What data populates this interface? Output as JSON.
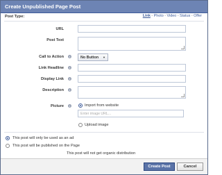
{
  "dialog": {
    "title": "Create Unpublished Page Post"
  },
  "post_type": {
    "label": "Post Type:",
    "options": [
      "Link",
      "Photo",
      "Video",
      "Status",
      "Offer"
    ],
    "separator": "-",
    "selected": "Link"
  },
  "fields": {
    "url_label": "URL",
    "post_text_label": "Post Text",
    "cta_label": "Call to Action",
    "cta_value": "No Button",
    "link_headline_label": "Link Headline",
    "display_link_label": "Display Link",
    "description_label": "Description",
    "picture_label": "Picture",
    "import_label": "Import from website",
    "image_url_placeholder": "Enter image URL...",
    "upload_label": "Upload image"
  },
  "distribution": {
    "ad_only_label": "This post will only be used as an ad",
    "published_label": "This post will be published on the Page",
    "note": "This post will not get organic distribution"
  },
  "footer": {
    "create_label": "Create Post",
    "cancel_label": "Cancel"
  },
  "colors": {
    "header_bg": "#6d84b4",
    "primary_button": "#5b74a8",
    "link": "#3b5998"
  }
}
